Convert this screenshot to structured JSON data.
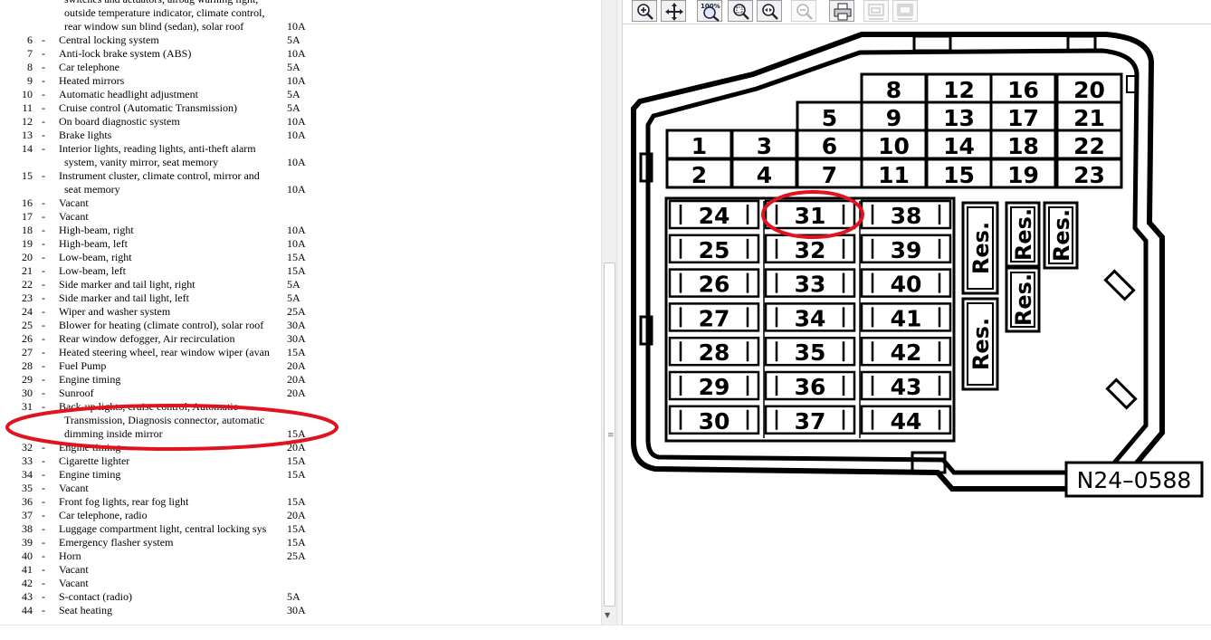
{
  "fuse_list": {
    "rows": [
      {
        "num": "",
        "desc": "",
        "cont": "switches and actuators, airbag warning light,",
        "amp": ""
      },
      {
        "num": "",
        "desc": "",
        "cont": "outside temperature indicator, climate control,",
        "amp": ""
      },
      {
        "num": "",
        "desc": "",
        "cont": "rear window sun blind (sedan), solar roof",
        "amp": "10A"
      },
      {
        "num": "6",
        "desc": "Central locking system",
        "cont": "",
        "amp": "5A"
      },
      {
        "num": "7",
        "desc": "Anti-lock brake system (ABS)",
        "cont": "",
        "amp": "10A"
      },
      {
        "num": "8",
        "desc": "Car telephone",
        "cont": "",
        "amp": "5A"
      },
      {
        "num": "9",
        "desc": "Heated mirrors",
        "cont": "",
        "amp": "10A"
      },
      {
        "num": "10",
        "desc": "Automatic headlight adjustment",
        "cont": "",
        "amp": "5A"
      },
      {
        "num": "11",
        "desc": "Cruise control (Automatic Transmission)",
        "cont": "",
        "amp": "5A"
      },
      {
        "num": "12",
        "desc": "On board diagnostic system",
        "cont": "",
        "amp": "10A"
      },
      {
        "num": "13",
        "desc": "Brake lights",
        "cont": "",
        "amp": "10A"
      },
      {
        "num": "14",
        "desc": "Interior lights, reading lights, anti-theft alarm",
        "cont": "",
        "amp": ""
      },
      {
        "num": "",
        "desc": "",
        "cont": "system, vanity mirror, seat memory",
        "amp": "10A"
      },
      {
        "num": "15",
        "desc": "Instrument cluster, climate control, mirror and",
        "cont": "",
        "amp": ""
      },
      {
        "num": "",
        "desc": "",
        "cont": "seat memory",
        "amp": "10A"
      },
      {
        "num": "16",
        "desc": "Vacant",
        "cont": "",
        "amp": ""
      },
      {
        "num": "17",
        "desc": "Vacant",
        "cont": "",
        "amp": ""
      },
      {
        "num": "18",
        "desc": "High-beam, right",
        "cont": "",
        "amp": "10A"
      },
      {
        "num": "19",
        "desc": "High-beam, left",
        "cont": "",
        "amp": "10A"
      },
      {
        "num": "20",
        "desc": "Low-beam, right",
        "cont": "",
        "amp": "15A"
      },
      {
        "num": "21",
        "desc": "Low-beam, left",
        "cont": "",
        "amp": "15A"
      },
      {
        "num": "22",
        "desc": "Side marker and tail light, right",
        "cont": "",
        "amp": "5A"
      },
      {
        "num": "23",
        "desc": "Side marker and tail light, left",
        "cont": "",
        "amp": "5A"
      },
      {
        "num": "24",
        "desc": "Wiper and washer system",
        "cont": "",
        "amp": "25A"
      },
      {
        "num": "25",
        "desc": "Blower for heating (climate control), solar roof",
        "cont": "",
        "amp": "30A"
      },
      {
        "num": "26",
        "desc": "Rear window defogger, Air recirculation",
        "cont": "",
        "amp": "30A"
      },
      {
        "num": "27",
        "desc": "Heated steering wheel, rear window wiper (avan",
        "cont": "",
        "amp": "15A"
      },
      {
        "num": "28",
        "desc": "Fuel Pump",
        "cont": "",
        "amp": "20A"
      },
      {
        "num": "29",
        "desc": "Engine timing",
        "cont": "",
        "amp": "20A"
      },
      {
        "num": "30",
        "desc": "Sunroof",
        "cont": "",
        "amp": "20A"
      },
      {
        "num": "31",
        "desc": "Back-up lights, cruise control, Automatic",
        "cont": "",
        "amp": ""
      },
      {
        "num": "",
        "desc": "",
        "cont": "Transmission, Diagnosis connector, automatic",
        "amp": ""
      },
      {
        "num": "",
        "desc": "",
        "cont": "dimming inside mirror",
        "amp": "15A"
      },
      {
        "num": "32",
        "desc": "Engine timing",
        "cont": "",
        "amp": "20A"
      },
      {
        "num": "33",
        "desc": "Cigarette lighter",
        "cont": "",
        "amp": "15A"
      },
      {
        "num": "34",
        "desc": "Engine timing",
        "cont": "",
        "amp": "15A"
      },
      {
        "num": "35",
        "desc": "Vacant",
        "cont": "",
        "amp": ""
      },
      {
        "num": "36",
        "desc": "Front fog lights, rear fog light",
        "cont": "",
        "amp": "15A"
      },
      {
        "num": "37",
        "desc": "Car telephone, radio",
        "cont": "",
        "amp": "20A"
      },
      {
        "num": "38",
        "desc": "Luggage compartment light, central locking sys",
        "cont": "",
        "amp": "15A"
      },
      {
        "num": "39",
        "desc": "Emergency flasher system",
        "cont": "",
        "amp": "15A"
      },
      {
        "num": "40",
        "desc": "Horn",
        "cont": "",
        "amp": "25A"
      },
      {
        "num": "41",
        "desc": "Vacant",
        "cont": "",
        "amp": ""
      },
      {
        "num": "42",
        "desc": "Vacant",
        "cont": "",
        "amp": ""
      },
      {
        "num": "43",
        "desc": "S-contact (radio)",
        "cont": "",
        "amp": "5A"
      },
      {
        "num": "44",
        "desc": "Seat heating",
        "cont": "",
        "amp": "30A"
      }
    ]
  },
  "toolbar": {
    "buttons": [
      {
        "name": "zoom-in-button",
        "icon": "zoom-in-icon",
        "enabled": true
      },
      {
        "name": "pan-button",
        "icon": "pan-icon",
        "enabled": true
      },
      {
        "name": "zoom-100-button",
        "icon": "zoom-100-icon",
        "label": "100%",
        "enabled": true
      },
      {
        "name": "zoom-area-button",
        "icon": "zoom-area-icon",
        "enabled": true
      },
      {
        "name": "zoom-fit-button",
        "icon": "zoom-fit-icon",
        "enabled": true
      },
      {
        "name": "zoom-out-button",
        "icon": "zoom-out-icon",
        "enabled": false
      },
      {
        "name": "print-button",
        "icon": "printer-icon",
        "enabled": true
      },
      {
        "name": "copy-button",
        "icon": "copy-icon",
        "enabled": false
      },
      {
        "name": "copy-all-button",
        "icon": "copy-all-icon",
        "enabled": false
      }
    ]
  },
  "diagram": {
    "upper_fuses": [
      "1",
      "2",
      "3",
      "4",
      "5",
      "6",
      "7",
      "8",
      "9",
      "10",
      "11",
      "12",
      "13",
      "14",
      "15",
      "16",
      "17",
      "18",
      "19",
      "20",
      "21",
      "22",
      "23"
    ],
    "lower_columns": [
      [
        "24",
        "25",
        "26",
        "27",
        "28",
        "29",
        "30"
      ],
      [
        "31",
        "32",
        "33",
        "34",
        "35",
        "36",
        "37"
      ],
      [
        "38",
        "39",
        "40",
        "41",
        "42",
        "43",
        "44"
      ]
    ],
    "reserve_label": "Res.",
    "figure_id": "N24–0588",
    "highlight_color": "#e0141e"
  }
}
